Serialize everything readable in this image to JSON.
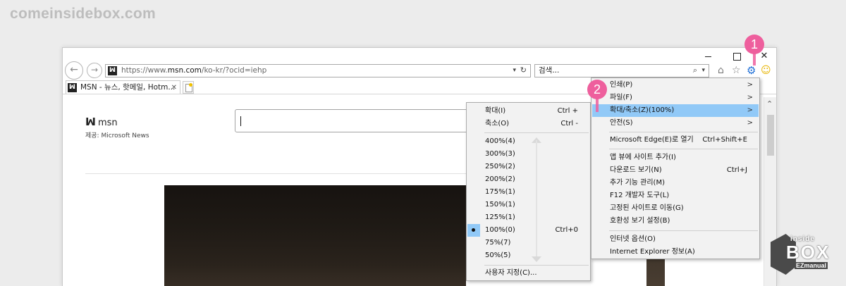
{
  "page": {
    "site_logo": "comeinsidebox.com"
  },
  "window": {
    "minimize_icon": "minimize-icon",
    "maximize_icon": "maximize-icon",
    "close_label": "✕"
  },
  "toolbar": {
    "back_icon": "arrow-left-icon",
    "forward_icon": "arrow-right-icon",
    "address_favicon": "msn-butterfly-icon",
    "url_prefix": "https://www.",
    "url_host": "msn.com",
    "url_path": "/ko-kr/?ocid=iehp",
    "address_dropdown": "▾",
    "refresh_label": "↻",
    "search_placeholder": "검색...",
    "search_icon": "⌕",
    "search_dropdown": "▾",
    "home_icon": "⌂",
    "favorites_icon": "☆",
    "tools_icon": "⚙",
    "feedback_icon": "☺"
  },
  "tab": {
    "title": "MSN - 뉴스, 핫메일, Hotm...",
    "close_label": "✕"
  },
  "msn": {
    "logo_text": "msn",
    "provider_text": "제공: Microsoft News"
  },
  "annotations": {
    "step1": "1",
    "step2": "2"
  },
  "main_menu": {
    "items": [
      {
        "label": "인쇄(P)",
        "shortcut": "",
        "arrow": ">"
      },
      {
        "label": "파일(F)",
        "shortcut": "",
        "arrow": ">"
      },
      {
        "label": "확대/축소(Z)(100%)",
        "shortcut": "",
        "arrow": ">"
      },
      {
        "label": "안전(S)",
        "shortcut": "",
        "arrow": ">"
      },
      {
        "label": "Microsoft Edge(E)로 열기",
        "shortcut": "Ctrl+Shift+E",
        "arrow": ""
      },
      {
        "label": "앱 뷰에 사이트 추가(I)",
        "shortcut": "",
        "arrow": ""
      },
      {
        "label": "다운로드 보기(N)",
        "shortcut": "Ctrl+J",
        "arrow": ""
      },
      {
        "label": "추가 기능 관리(M)",
        "shortcut": "",
        "arrow": ""
      },
      {
        "label": "F12 개발자 도구(L)",
        "shortcut": "",
        "arrow": ""
      },
      {
        "label": "고정된 사이트로 이동(G)",
        "shortcut": "",
        "arrow": ""
      },
      {
        "label": "호환성 보기 설정(B)",
        "shortcut": "",
        "arrow": ""
      },
      {
        "label": "인터넷 옵션(O)",
        "shortcut": "",
        "arrow": ""
      },
      {
        "label": "Internet Explorer 정보(A)",
        "shortcut": "",
        "arrow": ""
      }
    ]
  },
  "zoom_menu": {
    "items": [
      {
        "label": "확대(I)",
        "shortcut": "Ctrl +"
      },
      {
        "label": "축소(O)",
        "shortcut": "Ctrl -"
      },
      {
        "label": "400%(4)",
        "shortcut": ""
      },
      {
        "label": "300%(3)",
        "shortcut": ""
      },
      {
        "label": "250%(2)",
        "shortcut": ""
      },
      {
        "label": "200%(2)",
        "shortcut": ""
      },
      {
        "label": "175%(1)",
        "shortcut": ""
      },
      {
        "label": "150%(1)",
        "shortcut": ""
      },
      {
        "label": "125%(1)",
        "shortcut": ""
      },
      {
        "label": "100%(0)",
        "shortcut": "Ctrl+0"
      },
      {
        "label": "75%(7)",
        "shortcut": ""
      },
      {
        "label": "50%(5)",
        "shortcut": ""
      },
      {
        "label": "사용자 지정(C)...",
        "shortcut": ""
      }
    ],
    "selected_index": 9
  },
  "watermark": {
    "line1": "inside",
    "line2": "BOX",
    "line3": "EZmanual"
  },
  "colors": {
    "highlight": "#91c9f7",
    "annotation": "#ee5f9d",
    "gear": "#1f6fd6"
  }
}
